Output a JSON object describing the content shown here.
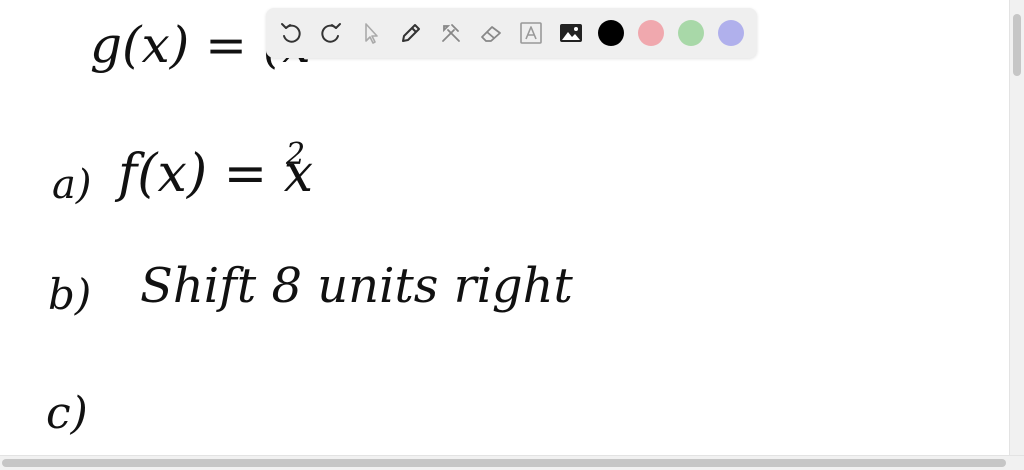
{
  "whiteboard": {
    "line_g": "g(x) = (x",
    "line_a_label": "a)",
    "line_a_expr": "f(x) = x",
    "line_a_exp": "2",
    "line_b_label": "b)",
    "line_b_text": "Shift 8 units right",
    "line_c_label": "c)"
  },
  "toolbar": {
    "tools": [
      "undo-icon",
      "redo-icon",
      "pointer-icon",
      "pen-icon",
      "tools-icon",
      "eraser-icon",
      "text-icon",
      "image-icon"
    ],
    "colors": [
      "#000000",
      "#f0a8ae",
      "#a8d8a8",
      "#b0b0ec"
    ]
  }
}
